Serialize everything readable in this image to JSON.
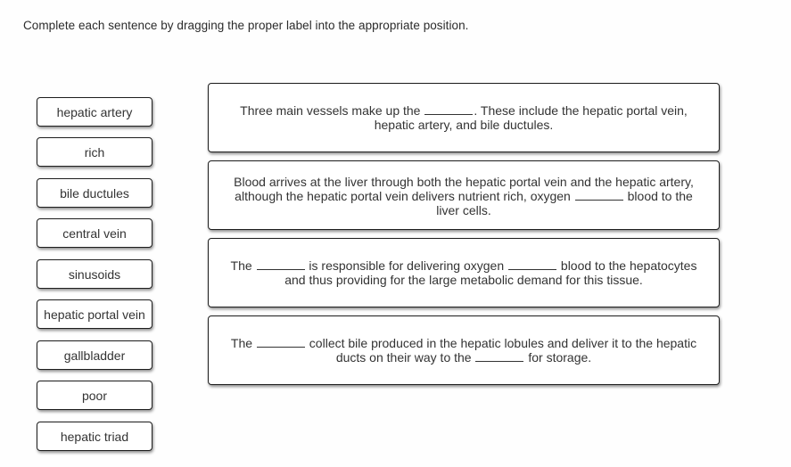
{
  "instructions": "Complete each sentence by dragging the proper label into the appropriate position.",
  "labels": [
    {
      "text": "hepatic artery"
    },
    {
      "text": "rich"
    },
    {
      "text": "bile ductules"
    },
    {
      "text": "central vein"
    },
    {
      "text": "sinusoids"
    },
    {
      "text": "hepatic portal vein"
    },
    {
      "text": "gallbladder"
    },
    {
      "text": "poor"
    },
    {
      "text": "hepatic triad"
    }
  ],
  "sentences": [
    {
      "parts": [
        "Three main vessels make up the ",
        ". These include the hepatic portal vein, hepatic artery, and bile ductules."
      ]
    },
    {
      "parts": [
        "Blood arrives at the liver through both the hepatic portal vein and the hepatic artery, although the hepatic portal vein delivers nutrient rich, oxygen ",
        " blood to the liver cells."
      ]
    },
    {
      "parts": [
        "The ",
        " is responsible for delivering oxygen ",
        " blood to the hepatocytes and thus providing for the large metabolic demand for this tissue."
      ]
    },
    {
      "parts": [
        "The ",
        " collect bile produced in the hepatic lobules and deliver it to the hepatic ducts on their way to the ",
        " for storage."
      ]
    }
  ]
}
